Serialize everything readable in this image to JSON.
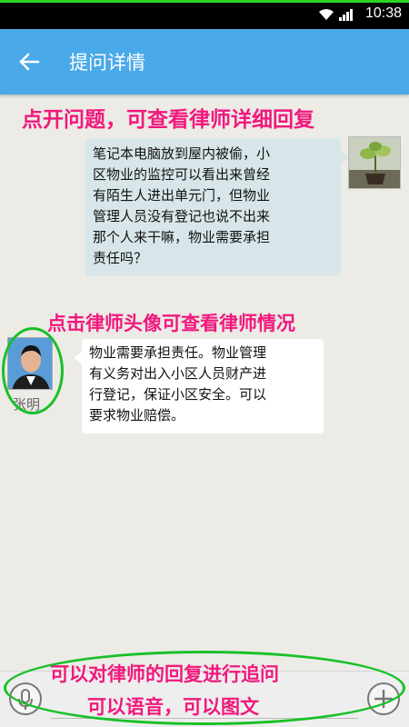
{
  "status_bar": {
    "time": "10:38",
    "progress": 1.0
  },
  "header": {
    "title": "提问详情",
    "back_icon": "arrow-left-icon"
  },
  "annotations": {
    "tap_question": "点开问题，可查看律师详细回复",
    "tap_avatar": "点击律师头像可查看律师情况",
    "follow_up": "可以对律师的回复进行追问",
    "voice_image": "可以语音，可以图文"
  },
  "question": {
    "lines": [
      "笔记本电脑放到屋内被偷，小",
      "区物业的监控可以看出来曾经",
      "有陌生人进出单元门，但物业",
      "管理人员没有登记也说不出来",
      "那个人来干嘛，物业需要承担",
      "责任吗？"
    ]
  },
  "answer": {
    "lawyer_name": "张明",
    "lines": [
      "物业需要承担责任。物业管理",
      "有义务对出入小区人员财产进",
      "行登记，保证小区安全。可以",
      "要求物业赔偿。"
    ]
  },
  "input_bar": {
    "placeholder": "",
    "mic_icon": "microphone-icon",
    "add_icon": "plus-icon"
  },
  "colors": {
    "app_bar": "#4aa9e8",
    "annotation": "#f2187d",
    "highlight_ring": "#18c028"
  }
}
